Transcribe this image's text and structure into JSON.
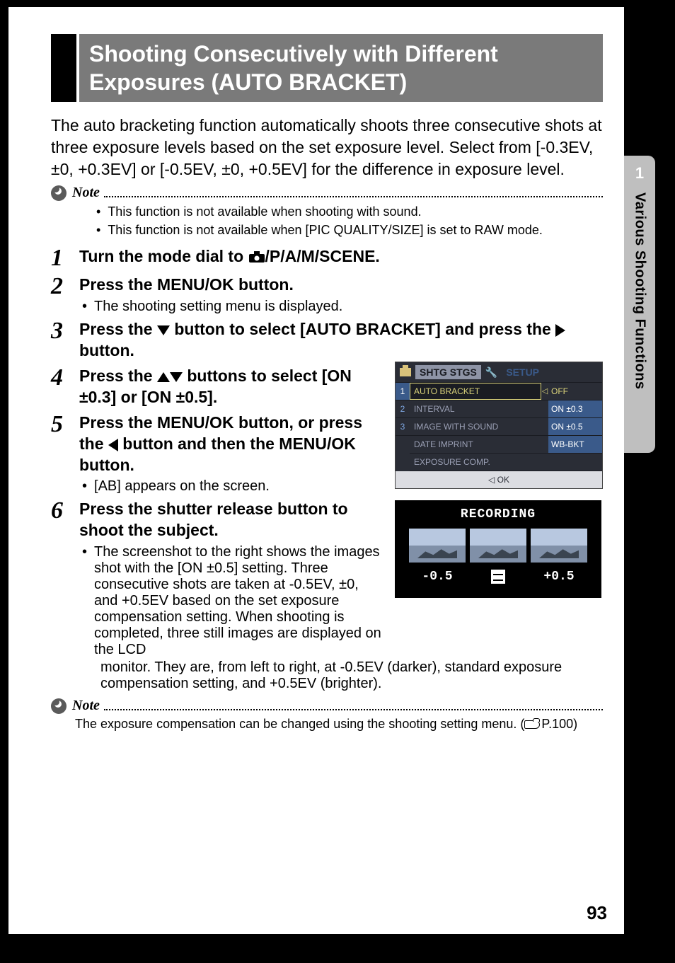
{
  "tab": {
    "number": "1",
    "label": "Various Shooting Functions"
  },
  "heading": "Shooting Consecutively with Different Exposures (AUTO BRACKET)",
  "intro": "The auto bracketing function automatically shoots three consecutive shots at three exposure levels based on the set exposure level. Select from [-0.3EV, ±0, +0.3EV] or [-0.5EV, ±0, +0.5EV] for the difference in exposure level.",
  "note1": {
    "label": "Note",
    "items": [
      "This function is not available when shooting with sound.",
      "This function is not available when [PIC QUALITY/SIZE] is set to RAW mode."
    ]
  },
  "steps": {
    "s1": {
      "num": "1",
      "title_pre": "Turn the mode dial to ",
      "title_post": "/P/A/M/SCENE."
    },
    "s2": {
      "num": "2",
      "title": "Press the MENU/OK button.",
      "sub": "The shooting setting menu is displayed."
    },
    "s3": {
      "num": "3",
      "title_pre": "Press the ",
      "title_mid": " button to select [AUTO BRACKET] and press the ",
      "title_post": " button."
    },
    "s4": {
      "num": "4",
      "title_pre": "Press the ",
      "title_post": " buttons to select [ON ±0.3] or [ON ±0.5]."
    },
    "s5": {
      "num": "5",
      "title_pre": "Press the MENU/OK button, or press the ",
      "title_post": " button and then the MENU/OK button.",
      "sub": "[AB] appears on the screen."
    },
    "s6": {
      "num": "6",
      "title": "Press the shutter release button to shoot the subject.",
      "sub": "The screenshot to the right shows the images shot with the [ON ±0.5] setting. Three consecutive shots are taken at -0.5EV, ±0, and +0.5EV based on the set exposure compensation setting. When shooting is completed, three still images are displayed on the LCD",
      "sub_cont": "monitor. They are, from left to right, at -0.5EV (darker), standard exposure compensation setting, and +0.5EV (brighter)."
    }
  },
  "lcd": {
    "tab1": "SHTG STGS",
    "tab2": "SETUP",
    "rows": [
      {
        "label": "AUTO BRACKET",
        "val": "OFF",
        "hl": true,
        "sel": false,
        "arrow": true
      },
      {
        "label": "INTERVAL",
        "val": "ON ±0.3",
        "hl": false,
        "sel": true
      },
      {
        "label": "IMAGE WITH SOUND",
        "val": "ON ±0.5",
        "hl": false,
        "sel": true
      },
      {
        "label": "DATE IMPRINT",
        "val": "WB-BKT",
        "hl": false,
        "sel": true
      },
      {
        "label": "EXPOSURE COMP.",
        "val": "",
        "hl": false,
        "sel": false
      }
    ],
    "nums": [
      "1",
      "2",
      "3"
    ],
    "footer_pre": "◁ ",
    "footer": "OK"
  },
  "rec": {
    "title": "RECORDING",
    "left": "-0.5",
    "right": "+0.5"
  },
  "note2": {
    "label": "Note",
    "text_pre": "The exposure compensation can be changed using the shooting setting menu. (",
    "text_post": "P.100)"
  },
  "page_number": "93"
}
